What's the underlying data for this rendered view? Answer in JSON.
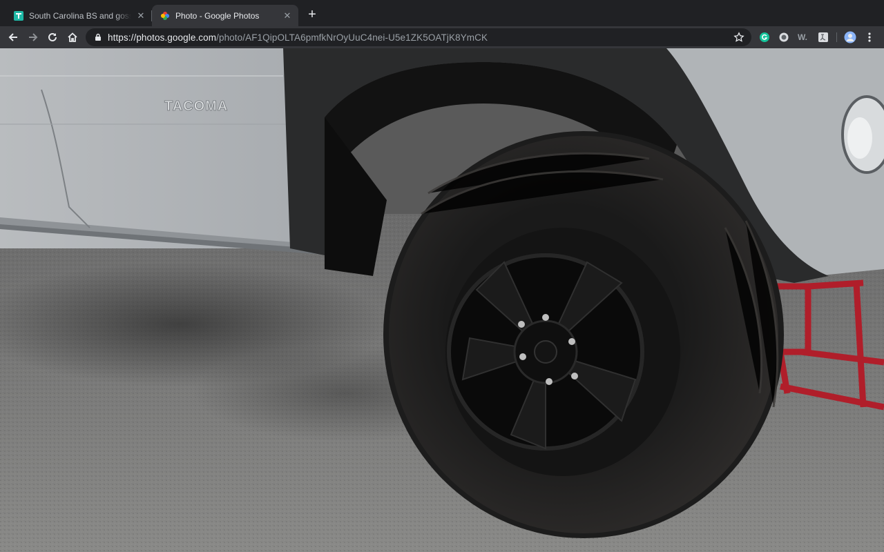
{
  "tabs": [
    {
      "title": "South Carolina BS and gossip for",
      "favicon": "square-t-favicon",
      "active": false
    },
    {
      "title": "Photo - Google Photos",
      "favicon": "google-photos-favicon",
      "active": true
    }
  ],
  "omnibox": {
    "url_scheme": "https://",
    "url_host": "photos.google.com",
    "url_path": "/photo/AF1QipOLTA6pmfkNrOyUuC4nei-U5e1ZK5OATjK8YmCK"
  },
  "photo": {
    "badge_text": "TACOMA"
  },
  "colors": {
    "tab_strip": "#202124",
    "toolbar": "#35363a",
    "accent_green": "#15c39a"
  }
}
